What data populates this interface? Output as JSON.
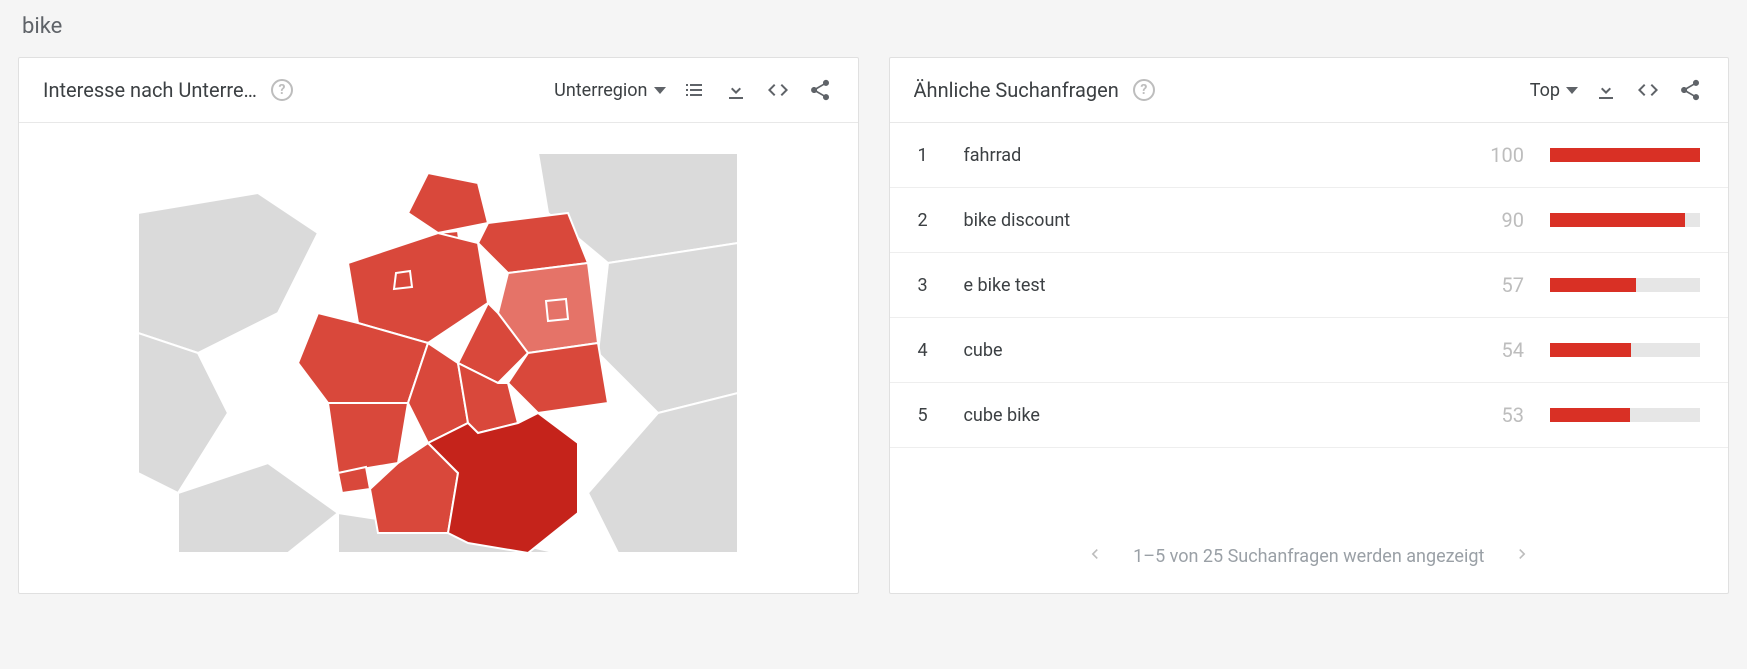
{
  "search_term": "bike",
  "left_card": {
    "title": "Interesse nach Unterre…",
    "dropdown_label": "Unterregion"
  },
  "right_card": {
    "title": "Ähnliche Suchanfragen",
    "dropdown_label": "Top",
    "queries": [
      {
        "rank": "1",
        "term": "fahrrad",
        "value": 100
      },
      {
        "rank": "2",
        "term": "bike discount",
        "value": 90
      },
      {
        "rank": "3",
        "term": "e bike test",
        "value": 57
      },
      {
        "rank": "4",
        "term": "cube",
        "value": 54
      },
      {
        "rank": "5",
        "term": "cube bike",
        "value": 53
      }
    ],
    "pager_text": "1–5 von 25 Suchanfragen werden angezeigt"
  },
  "colors": {
    "bg_land": "#dadada",
    "bg_border": "#ffffff",
    "shade_light": "#e57368",
    "shade_mid": "#d9483b",
    "shade_dark": "#c5231b",
    "accent": "#d93025"
  }
}
